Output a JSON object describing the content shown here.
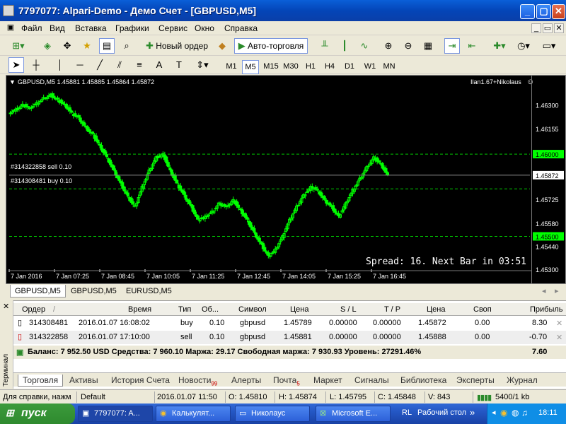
{
  "window": {
    "title": "7797077: Alpari-Demo - Демо Счет - [GBPUSD,M5]"
  },
  "menu": [
    "Файл",
    "Вид",
    "Вставка",
    "Графики",
    "Сервис",
    "Окно",
    "Справка"
  ],
  "toolbar": {
    "new_order": "Новый ордер",
    "autotrading": "Авто-торговля"
  },
  "timeframes": [
    "M1",
    "M5",
    "M15",
    "M30",
    "H1",
    "H4",
    "D1",
    "W1",
    "MN"
  ],
  "active_timeframe": "M5",
  "chart": {
    "header": "GBPUSD,M5  1.45881 1.45885 1.45864 1.45872",
    "expert": "Ilan1.67+Nikolaus",
    "order_sell": "#314322858 sell 0.10",
    "order_buy": "#314308481 buy 0.10",
    "footer": "Spread: 16. Next Bar in 03:51",
    "price_labels": [
      "1.46300",
      "1.46155",
      "1.45872",
      "1.45725",
      "1.45580",
      "1.45440",
      "1.45300"
    ],
    "highlight_labels": [
      "1.46000",
      "1.45500"
    ],
    "time_labels": [
      "7 Jan 2016",
      "7 Jan 07:25",
      "7 Jan 08:45",
      "7 Jan 10:05",
      "7 Jan 11:25",
      "7 Jan 12:45",
      "7 Jan 14:05",
      "7 Jan 15:25",
      "7 Jan 16:45"
    ],
    "colors": {
      "bg": "#000000",
      "candle": "#00ff00",
      "level": "#00c800",
      "price_tag": "#ffffff",
      "highlight_tag": "#00ff00"
    }
  },
  "chart_data": {
    "type": "candlestick",
    "symbol": "GBPUSD",
    "timeframe": "M5",
    "ylim": [
      1.453,
      1.464
    ],
    "xlabel": "",
    "ylabel": "",
    "x_ticks": [
      "7 Jan 2016",
      "7 Jan 07:25",
      "7 Jan 08:45",
      "7 Jan 10:05",
      "7 Jan 11:25",
      "7 Jan 12:45",
      "7 Jan 14:05",
      "7 Jan 15:25",
      "7 Jan 16:45"
    ],
    "close_series": [
      1.4625,
      1.4627,
      1.463,
      1.4628,
      1.4631,
      1.4634,
      1.4636,
      1.4633,
      1.463,
      1.4625,
      1.4622,
      1.4616,
      1.4612,
      1.4605,
      1.4598,
      1.459,
      1.4582,
      1.4574,
      1.4568,
      1.458,
      1.459,
      1.4598,
      1.46,
      1.459,
      1.4582,
      1.4575,
      1.4568,
      1.456,
      1.4562,
      1.4565,
      1.457,
      1.4568,
      1.4572,
      1.4566,
      1.456,
      1.4552,
      1.4545,
      1.4538,
      1.4542,
      1.455,
      1.456,
      1.4568,
      1.4575,
      1.458,
      1.4578,
      1.4572,
      1.4568,
      1.4562,
      1.457,
      1.4578,
      1.4585,
      1.4592,
      1.4598,
      1.4594,
      1.4587
    ],
    "levels": [
      1.46,
      1.45872,
      1.45789,
      1.455
    ],
    "current_price": 1.45872
  },
  "symbol_tabs": [
    "GBPUSD,M5",
    "GBPUSD,M5",
    "EURUSD,M5"
  ],
  "terminal": {
    "side_label": "Терминал",
    "columns": [
      "Ордер",
      "/",
      "Время",
      "Тип",
      "Об...",
      "Символ",
      "Цена",
      "S / L",
      "T / P",
      "Цена",
      "Своп",
      "Прибыль"
    ],
    "rows": [
      {
        "order": "314308481",
        "time": "2016.01.07 16:08:02",
        "type": "buy",
        "volume": "0.10",
        "symbol": "gbpusd",
        "price": "1.45789",
        "sl": "0.00000",
        "tp": "0.00000",
        "cur": "1.45872",
        "swap": "0.00",
        "profit": "8.30"
      },
      {
        "order": "314322858",
        "time": "2016.01.07 17:10:00",
        "type": "sell",
        "volume": "0.10",
        "symbol": "gbpusd",
        "price": "1.45881",
        "sl": "0.00000",
        "tp": "0.00000",
        "cur": "1.45888",
        "swap": "0.00",
        "profit": "-0.70"
      }
    ],
    "balance_line": "Баланс: 7 952.50 USD  Средства: 7 960.10  Маржа: 29.17  Свободная маржа: 7 930.93  Уровень: 27291.46%",
    "balance_total": "7.60",
    "tabs": [
      "Торговля",
      "Активы",
      "История Счета",
      "Новости",
      "Алерты",
      "Почта",
      "Маркет",
      "Сигналы",
      "Библиотека",
      "Эксперты",
      "Журнал"
    ],
    "news_count": "99",
    "mail_count": "5"
  },
  "status": {
    "help": "Для справки, нажм",
    "profile": "Default",
    "datetime": "2016.01.07 11:50",
    "o": "O: 1.45810",
    "h": "H: 1.45874",
    "l": "L: 1.45795",
    "c": "C: 1.45848",
    "v": "V: 843",
    "traffic": "5400/1 kb"
  },
  "taskbar": {
    "start": "пуск",
    "buttons": [
      "7797077: A...",
      "Калькулят...",
      "Николаус",
      "Microsoft E..."
    ],
    "lang": "RL",
    "desktop": "Рабочий стол",
    "clock": "18:11"
  }
}
